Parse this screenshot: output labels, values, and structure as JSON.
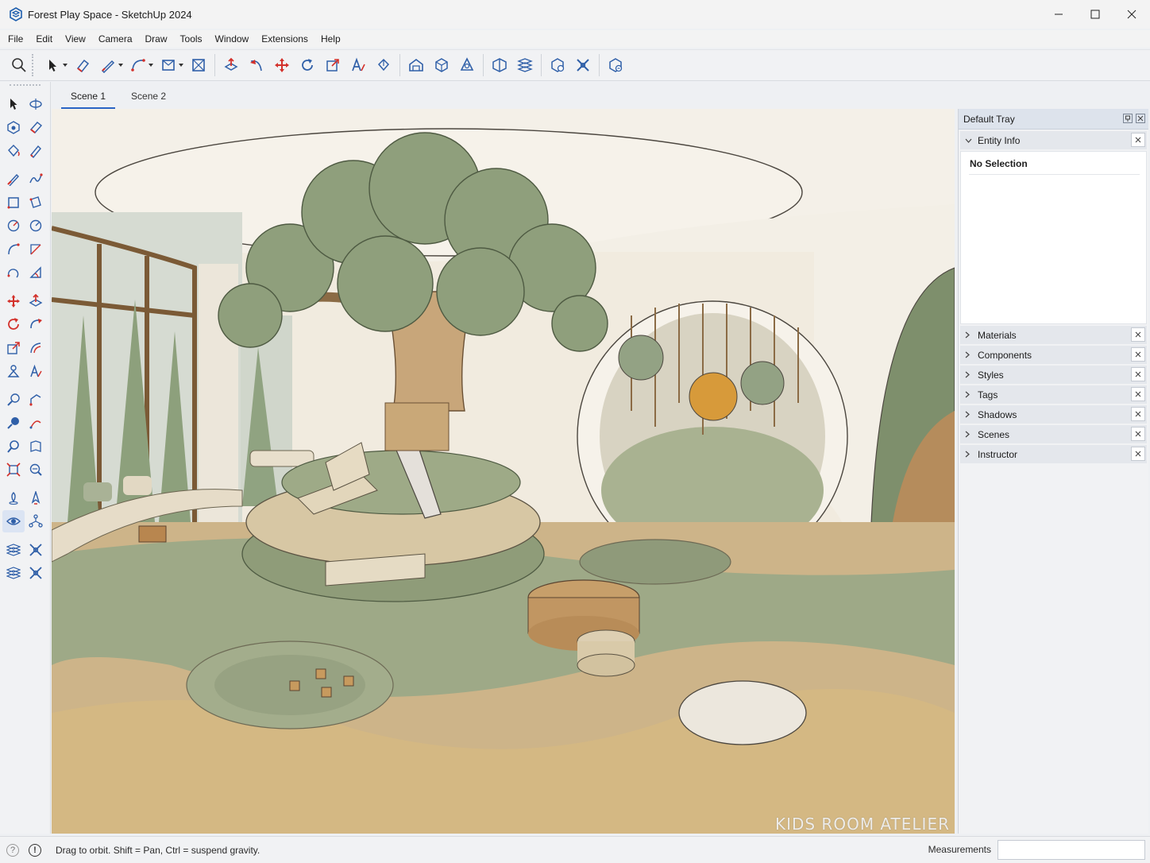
{
  "window": {
    "title": "Forest Play Space - SketchUp 2024",
    "icons": [
      "minimize-icon",
      "maximize-icon",
      "close-icon"
    ]
  },
  "menu": [
    "File",
    "Edit",
    "View",
    "Camera",
    "Draw",
    "Tools",
    "Window",
    "Extensions",
    "Help"
  ],
  "toolbar": {
    "tools": [
      "search",
      "select",
      "eraser",
      "line",
      "arc",
      "shape",
      "section-plane",
      "push-pull",
      "follow-me",
      "move",
      "rotate",
      "scale",
      "text",
      "paint-bucket",
      "warehouse",
      "components",
      "styles",
      "solid-tools",
      "sandbox",
      "extension-manager",
      "layout",
      "send-to-layout"
    ]
  },
  "scenes": {
    "tabs": [
      "Scene 1",
      "Scene 2"
    ],
    "active": "Scene 1"
  },
  "viewport": {
    "watermark": "KIDS ROOM ATELIER"
  },
  "tray": {
    "title": "Default Tray",
    "entity_info": {
      "label": "Entity Info",
      "selection": "No Selection"
    },
    "panels": [
      "Materials",
      "Components",
      "Styles",
      "Tags",
      "Shadows",
      "Scenes",
      "Instructor"
    ]
  },
  "status": {
    "hint": "Drag to orbit. Shift = Pan, Ctrl = suspend gravity.",
    "measurements_label": "Measurements",
    "measurements_value": ""
  },
  "colors": {
    "accent": "#2a64c5",
    "icon_blue": "#2f5fa8",
    "icon_red": "#d3312b"
  }
}
